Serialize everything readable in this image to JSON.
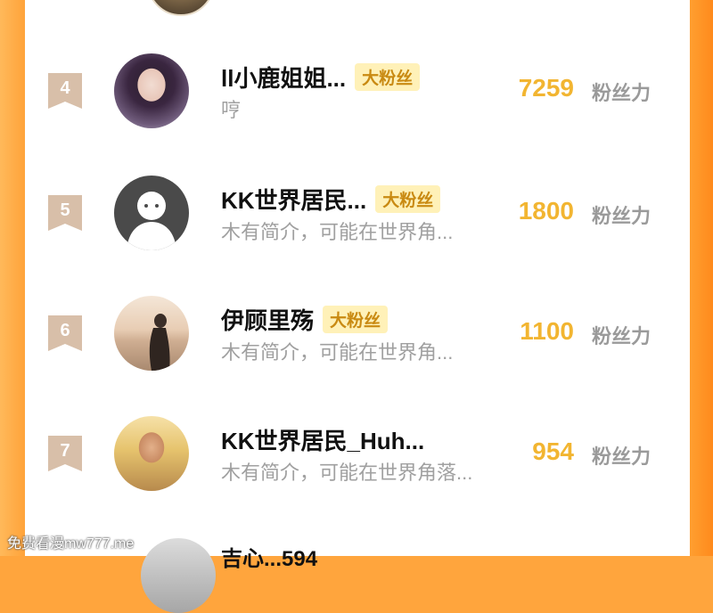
{
  "rows": [
    {
      "rank": "4",
      "name": "ll小鹿姐姐...",
      "tag": "大粉丝",
      "bio": "哼",
      "count": "7259",
      "count_label": "粉丝力"
    },
    {
      "rank": "5",
      "name": "KK世界居民...",
      "tag": "大粉丝",
      "bio": "木有简介，可能在世界角...",
      "count": "1800",
      "count_label": "粉丝力"
    },
    {
      "rank": "6",
      "name": "伊顾里殇",
      "tag": "大粉丝",
      "bio": "木有简介，可能在世界角...",
      "count": "1100",
      "count_label": "粉丝力"
    },
    {
      "rank": "7",
      "name": "KK世界居民_Huh...",
      "bio": "木有简介，可能在世界角落...",
      "count": "954",
      "count_label": "粉丝力"
    }
  ],
  "partial_next_name": "吉心...594",
  "watermark": "免费看漫mw777.me",
  "colors": {
    "frame": "#ffa53d",
    "count": "#f2b531",
    "tag_bg": "#fff1b8",
    "tag_text": "#c98a12",
    "badge": "#d8bfa9"
  }
}
